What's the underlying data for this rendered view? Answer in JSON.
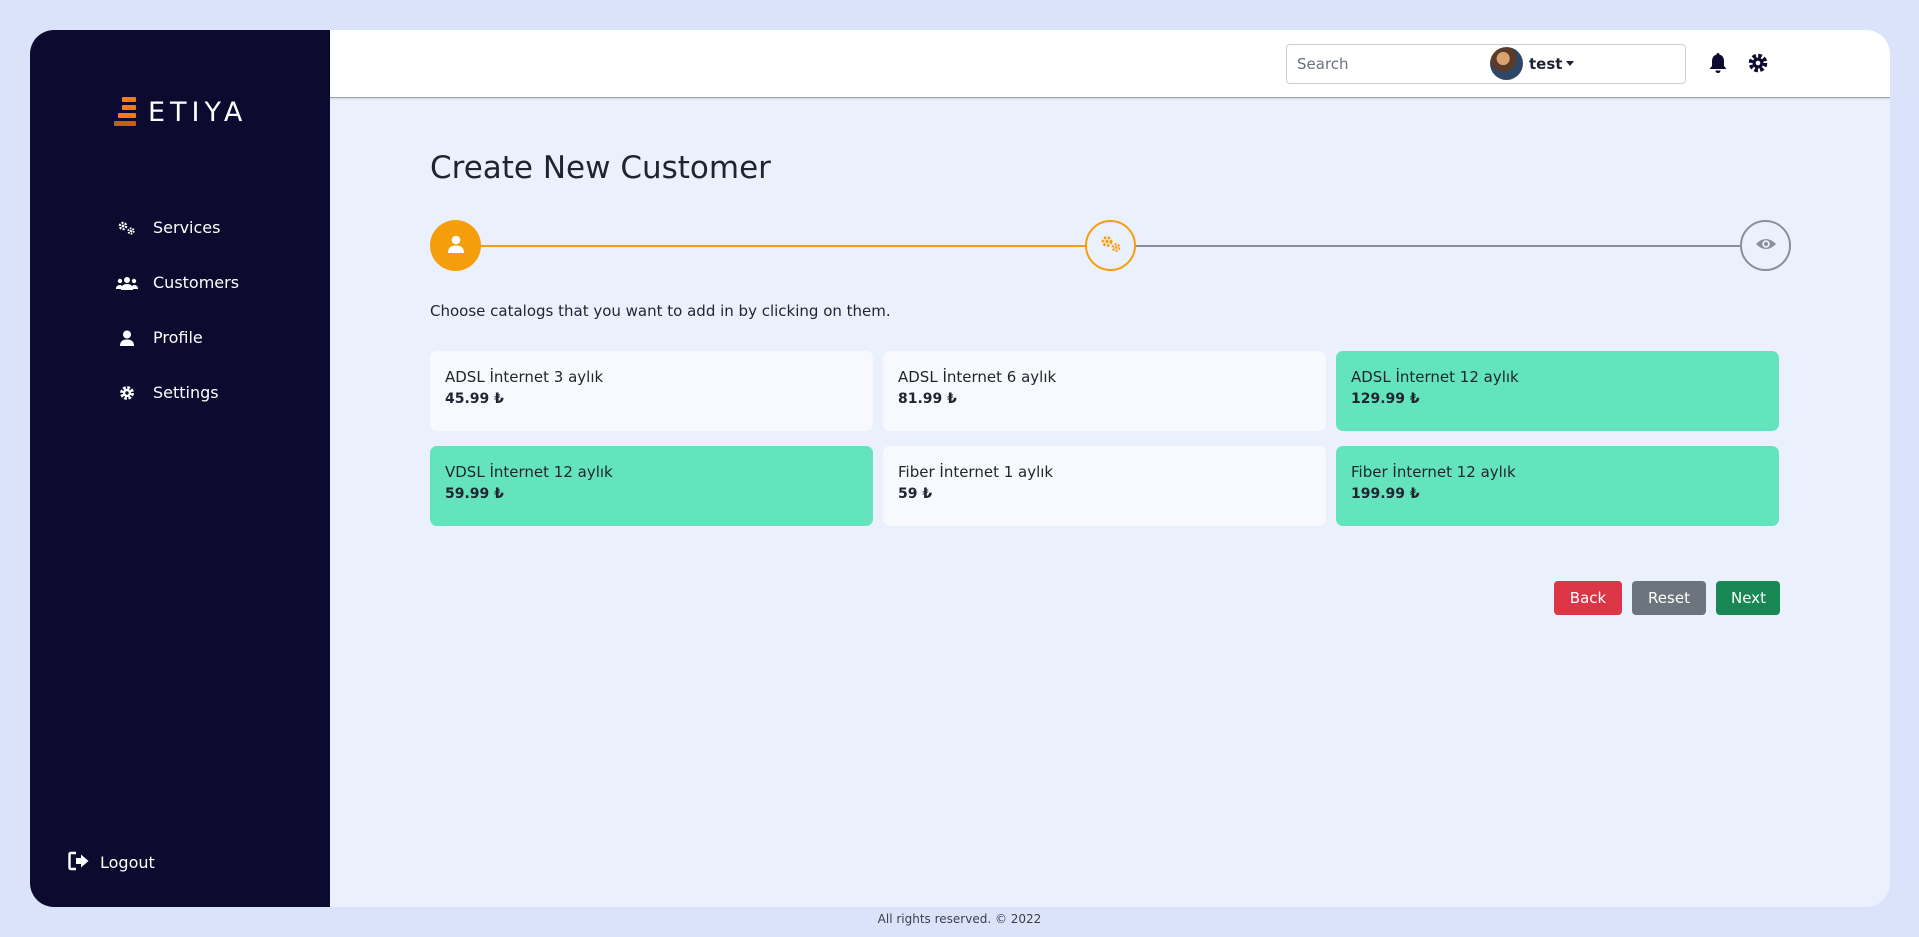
{
  "brand": {
    "name": "ETIYA"
  },
  "sidebar": {
    "items": [
      {
        "label": "Services",
        "icon": "cogs-icon"
      },
      {
        "label": "Customers",
        "icon": "users-icon"
      },
      {
        "label": "Profile",
        "icon": "user-icon"
      },
      {
        "label": "Settings",
        "icon": "gear-icon"
      }
    ],
    "logout": {
      "label": "Logout",
      "icon": "sign-out-icon"
    }
  },
  "header": {
    "search": {
      "placeholder": "Search",
      "value": ""
    },
    "user": {
      "name": "test"
    }
  },
  "main": {
    "title": "Create New Customer",
    "hint": "Choose catalogs that you want to add in by clicking on them.",
    "stepper": {
      "steps": [
        {
          "icon": "user-icon",
          "state": "completed"
        },
        {
          "icon": "cogs-icon",
          "state": "active"
        },
        {
          "icon": "eye-icon",
          "state": "pending"
        }
      ]
    },
    "catalogs": [
      {
        "name": "ADSL İnternet 3 aylık",
        "price": "45.99 ₺",
        "selected": false
      },
      {
        "name": "ADSL İnternet 6 aylık",
        "price": "81.99 ₺",
        "selected": false
      },
      {
        "name": "ADSL İnternet 12 aylık",
        "price": "129.99 ₺",
        "selected": true
      },
      {
        "name": "VDSL İnternet 12 aylık",
        "price": "59.99 ₺",
        "selected": true
      },
      {
        "name": "Fiber İnternet 1 aylık",
        "price": "59 ₺",
        "selected": false
      },
      {
        "name": "Fiber İnternet 12 aylık",
        "price": "199.99 ₺",
        "selected": true
      }
    ],
    "buttons": {
      "back": "Back",
      "reset": "Reset",
      "next": "Next"
    }
  },
  "footer": {
    "text": "All rights reserved. © 2022"
  },
  "colors": {
    "sidebar_bg": "#0c0a2e",
    "accent": "#f59e0b",
    "selected_card": "#63e4bd",
    "back": "#dc3545",
    "reset": "#6c757d",
    "next": "#198754"
  }
}
